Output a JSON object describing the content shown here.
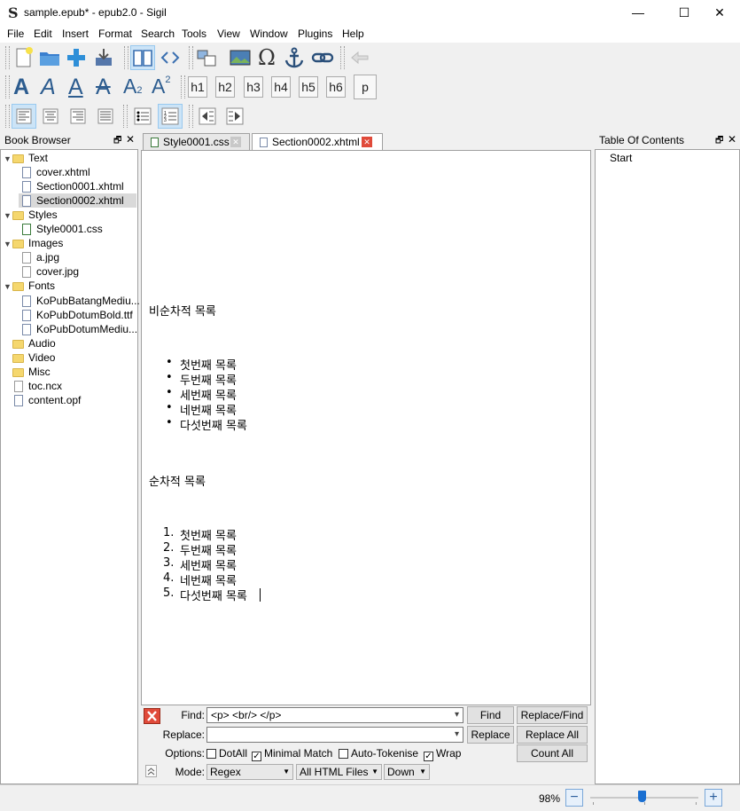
{
  "window": {
    "app_icon": "S",
    "title": "sample.epub* - epub2.0 - Sigil",
    "minimize": "—",
    "maximize": "☐",
    "close": "✕"
  },
  "menu": [
    "File",
    "Edit",
    "Insert",
    "Format",
    "Search",
    "Tools",
    "View",
    "Window",
    "Plugins",
    "Help"
  ],
  "toolbar": {
    "headings": [
      "h1",
      "h2",
      "h3",
      "h4",
      "h5",
      "h6",
      "p"
    ],
    "font_letter": "A",
    "subscript": "2",
    "superscript": "2"
  },
  "book_browser": {
    "title": "Book Browser",
    "float": "🗗",
    "close": "✕",
    "items": [
      {
        "label": "Text",
        "type": "folder"
      },
      {
        "label": "cover.xhtml",
        "type": "file"
      },
      {
        "label": "Section0001.xhtml",
        "type": "file"
      },
      {
        "label": "Section0002.xhtml",
        "type": "file"
      },
      {
        "label": "Styles",
        "type": "folder"
      },
      {
        "label": "Style0001.css",
        "type": "file"
      },
      {
        "label": "Images",
        "type": "folder"
      },
      {
        "label": "a.jpg",
        "type": "file"
      },
      {
        "label": "cover.jpg",
        "type": "file"
      },
      {
        "label": "Fonts",
        "type": "folder"
      },
      {
        "label": "KoPubBatangMediu...",
        "type": "file"
      },
      {
        "label": "KoPubDotumBold.ttf",
        "type": "file"
      },
      {
        "label": "KoPubDotumMediu...",
        "type": "file"
      },
      {
        "label": "Audio",
        "type": "folder"
      },
      {
        "label": "Video",
        "type": "folder"
      },
      {
        "label": "Misc",
        "type": "folder"
      },
      {
        "label": "toc.ncx",
        "type": "file"
      },
      {
        "label": "content.opf",
        "type": "file"
      }
    ]
  },
  "tabs": [
    {
      "label": "Style0001.css",
      "close": "✕"
    },
    {
      "label": "Section0002.xhtml",
      "close": "✕"
    }
  ],
  "editor": {
    "heading1": "비순차적 목록",
    "unordered": [
      "첫번째 목록",
      "두번째 목록",
      "세번째 목록",
      "네번째 목록",
      "다섯번째 목록"
    ],
    "heading2": "순차적 목록",
    "ordered_markers": [
      "1.",
      "2.",
      "3.",
      "4.",
      "5."
    ],
    "ordered": [
      "첫번째 목록",
      "두번째 목록",
      "세번째 목록",
      "네번째 목록",
      "다섯번째 목록"
    ],
    "bullet": "•"
  },
  "toc": {
    "title": "Table Of Contents",
    "float": "🗗",
    "close": "✕",
    "items": [
      "Start"
    ]
  },
  "find_replace": {
    "find_label": "Find:",
    "find_value": "<p> <br/> </p>",
    "replace_label": "Replace:",
    "replace_value": "",
    "options_label": "Options:",
    "mode_label": "Mode:",
    "buttons": {
      "find": "Find",
      "replace_find": "Replace/Find",
      "replace": "Replace",
      "replace_all": "Replace All",
      "count_all": "Count All"
    },
    "options": [
      {
        "label": "DotAll",
        "checked": false
      },
      {
        "label": "Minimal Match",
        "checked": true
      },
      {
        "label": "Auto-Tokenise",
        "checked": false
      },
      {
        "label": "Wrap",
        "checked": true
      }
    ],
    "mode": "Regex",
    "scope": "All HTML Files",
    "direction": "Down",
    "check_mark": "✓",
    "dropdown_arrow": "▾"
  },
  "status": {
    "zoom": "98%",
    "zoom_out": "−",
    "zoom_in": "+",
    "zoom_level_fraction": 0.48
  },
  "colors": {
    "accent": "#cce4f7",
    "close_red": "#e04a3a",
    "folder": "#f5d76e",
    "slider": "#1a6fd1"
  }
}
